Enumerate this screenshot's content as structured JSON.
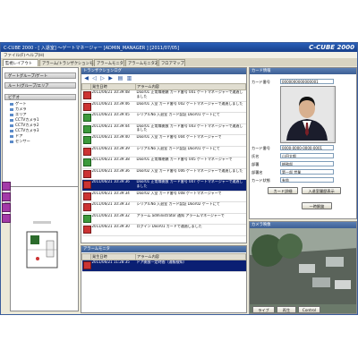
{
  "window": {
    "title": "C-CUBE 2000 - [ 入退室] ～ゲートマネージャー [ADMIN_MANAGER ] [2011/07/05]",
    "logo": "C-CUBE 2000"
  },
  "menu": [
    "ファイル(F)",
    "ヘルプ(H)"
  ],
  "tabs": [
    {
      "label": "監視レイアウト"
    },
    {
      "label": "アラーム/トランザクションモニタ"
    },
    {
      "label": "アラームモニタ"
    },
    {
      "label": "アラームモニタ2"
    },
    {
      "label": "フロアマップ"
    }
  ],
  "left_panel": {
    "groups": [
      "ゲートグループ/ゲート",
      "ルート/グループ/エリア",
      "ビデオ",
      "機器グループ/エリア"
    ],
    "tree_items": [
      "ゲート",
      "カメラ",
      "エリア",
      "CCTVカメラ1",
      "CCTVカメラ2",
      "CCTVカメラ3",
      "ドア",
      "センサー"
    ]
  },
  "log_panel": {
    "title": "トランザクションログ",
    "columns": [
      "",
      "発生日時",
      "アラーム内容"
    ],
    "rows": [
      {
        "icon": "red",
        "time": "2011/06/21 10:39:48",
        "text": "Door01 正常扉閉鎖 カード番号 001 ゲートマネージャーで通過しました",
        "selected": false
      },
      {
        "icon": "red",
        "time": "2011/06/21 10:39:46",
        "text": "Door01 入室 カード番号 002 ゲートマネージャーで通過しました",
        "selected": false
      },
      {
        "icon": "green",
        "time": "2011/06/21 10:39:45",
        "text": "シリアルNo 入退室 カード認証 Door01 ゲートにて",
        "selected": false
      },
      {
        "icon": "green",
        "time": "2011/06/21 10:39:44",
        "text": "Door01 正常扉開放 カード番号 003 ゲートマネージャーで通過しました",
        "selected": false
      },
      {
        "icon": "green",
        "time": "2011/06/21 10:39:40",
        "text": "Door01 入室 カード番号 004 ゲートマネージャーで",
        "selected": false
      },
      {
        "icon": "red",
        "time": "2011/06/21 10:39:39",
        "text": "シリアルNo 入退室 カード認証 Door01 ゲートにて",
        "selected": false
      },
      {
        "icon": "green",
        "time": "2011/06/21 10:39:38",
        "text": "Door01 正常扉閉鎖 カード番号 005 ゲートマネージャーで",
        "selected": false
      },
      {
        "icon": "red",
        "time": "2011/06/21 10:39:36",
        "text": "Door02 入室 カード番号 006 ゲートマネージャーで通過しました",
        "selected": false
      },
      {
        "icon": "red",
        "time": "2011/06/21 10:39:36",
        "text": "Door01 正常扉開放 カード番号 007 ゲートマネージャーで通過しました",
        "selected": true
      },
      {
        "icon": "red",
        "time": "2011/06/21 10:39:34",
        "text": "Door02 入室 カード番号 008 ゲートマネージャーで",
        "selected": false
      },
      {
        "icon": "red",
        "time": "2011/06/21 10:39:33",
        "text": "シリアルNo 入退室 カード認証 Door02 ゲートにて",
        "selected": false
      },
      {
        "icon": "green",
        "time": "2011/06/21 10:39:32",
        "text": "アラーム administrator 通知 アラームマネージャーで",
        "selected": false
      },
      {
        "icon": "red",
        "time": "2011/06/21 10:39:30",
        "text": "ログイン Door01 カードで通過しました",
        "selected": false
      }
    ]
  },
  "alarm_panel": {
    "title": "アラームモニタ",
    "columns": [
      "",
      "発生日時",
      "アラーム内容"
    ],
    "rows": [
      {
        "time": "2011/06/21 11:28:35",
        "text": "ドア開放一定時間（通報検知）"
      }
    ]
  },
  "profile_panel": {
    "title": "カード情報",
    "card_label": "カード番号",
    "card_value": "0000000000000001",
    "fields": [
      {
        "label": "カード番号",
        "value": "0000-0000-0000-0001"
      },
      {
        "label": "氏名",
        "value": "山田太郎"
      },
      {
        "label": "部署",
        "value": "総務部"
      },
      {
        "label": "部署名",
        "value": "第一部 営業"
      },
      {
        "label": "カード状態",
        "value": "有効"
      }
    ],
    "buttons": [
      "カード詳細",
      "入退室履歴表示",
      "一時解錠"
    ]
  },
  "camera_panel": {
    "title": "カメラ映像"
  },
  "status_buttons": [
    "ライブ",
    "再生",
    "Control"
  ]
}
